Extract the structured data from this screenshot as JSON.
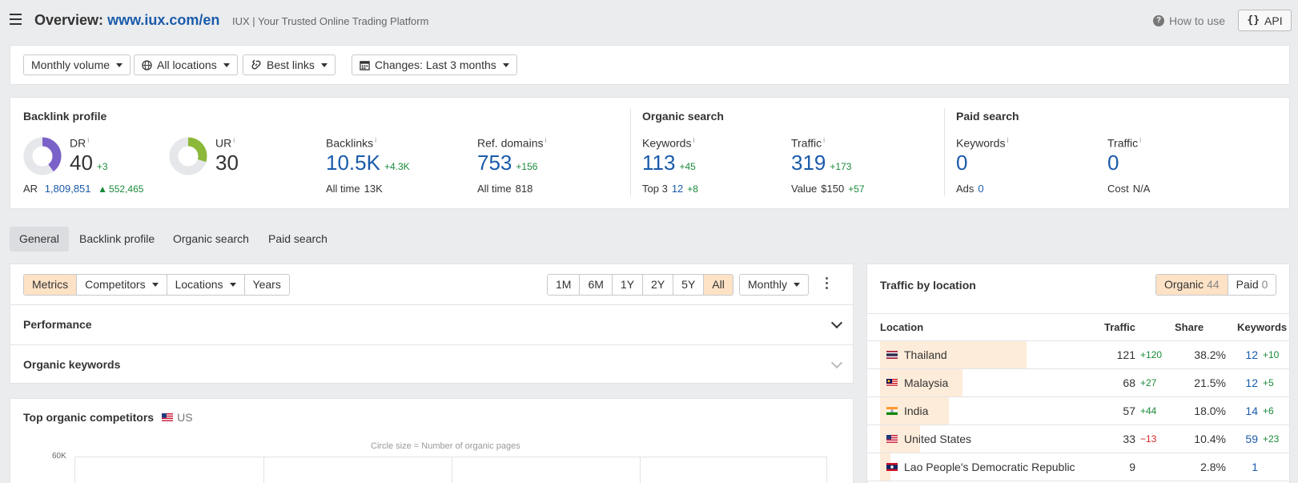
{
  "header": {
    "title_prefix": "Overview:",
    "domain": "www.iux.com/en",
    "subtitle": "IUX | Your Trusted Online Trading Platform",
    "how_to_use": "How to use",
    "api": "API"
  },
  "filters": {
    "volume": "Monthly volume",
    "locations": "All locations",
    "links": "Best links",
    "changes": "Changes: Last 3 months"
  },
  "backlink_profile": {
    "title": "Backlink profile",
    "dr_label": "DR",
    "dr_value": "40",
    "dr_change": "+3",
    "dr_fraction": 0.4,
    "ar_label": "AR",
    "ar_value": "1,809,851",
    "ar_change": "552,465",
    "ur_label": "UR",
    "ur_value": "30",
    "ur_fraction": 0.3,
    "backlinks_label": "Backlinks",
    "backlinks_value": "10.5K",
    "backlinks_change": "+4.3K",
    "backlinks_alltime_label": "All time",
    "backlinks_alltime": "13K",
    "refdomains_label": "Ref. domains",
    "refdomains_value": "753",
    "refdomains_change": "+156",
    "refdomains_alltime_label": "All time",
    "refdomains_alltime": "818"
  },
  "organic_search": {
    "title": "Organic search",
    "keywords_label": "Keywords",
    "keywords_value": "113",
    "keywords_change": "+45",
    "top3_label": "Top 3",
    "top3_value": "12",
    "top3_change": "+8",
    "traffic_label": "Traffic",
    "traffic_value": "319",
    "traffic_change": "+173",
    "value_label": "Value",
    "value_value": "$150",
    "value_change": "+57"
  },
  "paid_search": {
    "title": "Paid search",
    "keywords_label": "Keywords",
    "keywords_value": "0",
    "ads_label": "Ads",
    "ads_value": "0",
    "traffic_label": "Traffic",
    "traffic_value": "0",
    "cost_label": "Cost",
    "cost_value": "N/A"
  },
  "info_mark": "i",
  "tabs": [
    "General",
    "Backlink profile",
    "Organic search",
    "Paid search"
  ],
  "chart_controls": {
    "segments": [
      "Metrics",
      "Competitors",
      "Locations",
      "Years"
    ],
    "ranges": [
      "1M",
      "6M",
      "1Y",
      "2Y",
      "5Y",
      "All"
    ],
    "interval": "Monthly"
  },
  "sections": {
    "performance": "Performance",
    "organic_keywords": "Organic keywords"
  },
  "competitors": {
    "title": "Top organic competitors",
    "country": "US",
    "note": "Circle size = Number of organic pages",
    "y_tick": "60K"
  },
  "traffic_by_location": {
    "title": "Traffic by location",
    "organic_label": "Organic",
    "organic_count": "44",
    "paid_label": "Paid",
    "paid_count": "0",
    "columns": [
      "Location",
      "Traffic",
      "Share",
      "Keywords"
    ],
    "rows": [
      {
        "name": "Thailand",
        "traffic": "121",
        "traffic_change": "+120",
        "share": "38.2%",
        "share_fraction": 0.382,
        "keywords": "12",
        "keywords_change": "+10",
        "traffic_dir": "up"
      },
      {
        "name": "Malaysia",
        "traffic": "68",
        "traffic_change": "+27",
        "share": "21.5%",
        "share_fraction": 0.215,
        "keywords": "12",
        "keywords_change": "+5",
        "traffic_dir": "up"
      },
      {
        "name": "India",
        "traffic": "57",
        "traffic_change": "+44",
        "share": "18.0%",
        "share_fraction": 0.18,
        "keywords": "14",
        "keywords_change": "+6",
        "traffic_dir": "up"
      },
      {
        "name": "United States",
        "traffic": "33",
        "traffic_change": "−13",
        "share": "10.4%",
        "share_fraction": 0.104,
        "keywords": "59",
        "keywords_change": "+23",
        "traffic_dir": "down"
      },
      {
        "name": "Lao People's Democratic Republic",
        "traffic": "9",
        "traffic_change": "",
        "share": "2.8%",
        "share_fraction": 0.028,
        "keywords": "1",
        "keywords_change": "",
        "traffic_dir": "none"
      }
    ]
  },
  "colors": {
    "dr_ring": "#7b62c9",
    "ur_ring": "#8cb83a",
    "ring_bg": "#e6e7ea",
    "link_blue": "#1a5bab",
    "positive": "#1a8a3a",
    "negative": "#d3262b",
    "highlight": "#fde2c6"
  }
}
